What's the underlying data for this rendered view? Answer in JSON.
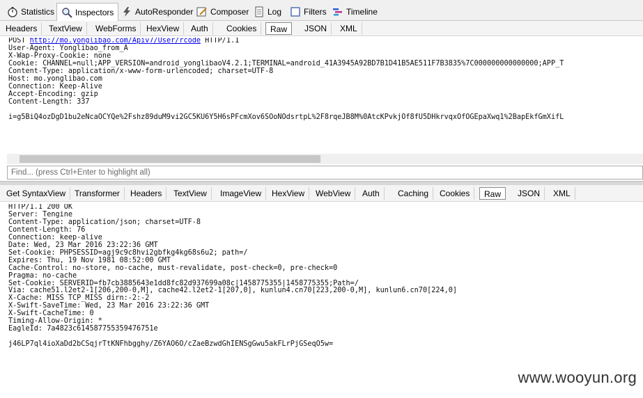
{
  "toolbar": {
    "tabs": [
      {
        "label": "Statistics",
        "icon": "stopwatch-icon"
      },
      {
        "label": "Inspectors",
        "icon": "magnifier-icon"
      },
      {
        "label": "AutoResponder",
        "icon": "lightning-icon"
      },
      {
        "label": "Composer",
        "icon": "pencil-icon"
      },
      {
        "label": "Log",
        "icon": "document-icon"
      },
      {
        "label": "Filters",
        "icon": "checkbox-icon"
      },
      {
        "label": "Timeline",
        "icon": "timeline-icon"
      }
    ],
    "active": "Inspectors"
  },
  "request": {
    "tabs": [
      "Headers",
      "TextView",
      "WebForms",
      "HexView",
      "Auth",
      "Cookies",
      "Raw",
      "JSON",
      "XML"
    ],
    "selected_tab": "Raw",
    "method": "POST ",
    "url": "http://mo.yonglibao.com/Apiv7/User/rcode",
    "protocol": " HTTP/1.1",
    "lines": [
      "User-Agent: Yonglibao_from_A",
      "X-Wap-Proxy-Cookie: none",
      "Cookie: CHANNEL=null;APP_VERSION=android_yonglibaoV4.2.1;TERMINAL=android_41A3945A92BD7B1D41B5AE511F7B3835%7C000000000000000;APP_T",
      "Content-Type: application/x-www-form-urlencoded; charset=UTF-8",
      "Host: mo.yonglibao.com",
      "Connection: Keep-Alive",
      "Accept-Encoding: gzip",
      "Content-Length: 337",
      "",
      "i=g5BiQ4ozDgD1bu2eNcaOCYQe%2Fshz89duM9vi2GC5KU6Y5H6sPFcmXov6SOoNOdsrtpL%2F8rqeJB8M%0AtcKPvkjOf8fU5DHkrvqxOfOGEpaXwq1%2BapEkfGmXifL"
    ]
  },
  "find": {
    "placeholder": "Find... (press Ctrl+Enter to highlight all)"
  },
  "response": {
    "tabs": [
      "Get SyntaxView",
      "Transformer",
      "Headers",
      "TextView",
      "ImageView",
      "HexView",
      "WebView",
      "Auth",
      "Caching",
      "Cookies",
      "Raw",
      "JSON",
      "XML"
    ],
    "selected_tab": "Raw",
    "lines": [
      "HTTP/1.1 200 OK",
      "Server: Tengine",
      "Content-Type: application/json; charset=UTF-8",
      "Content-Length: 76",
      "Connection: keep-alive",
      "Date: Wed, 23 Mar 2016 23:22:36 GMT",
      "Set-Cookie: PHPSESSID=agj9c9c8hvi2gbfkg4kg68s6u2; path=/",
      "Expires: Thu, 19 Nov 1981 08:52:00 GMT",
      "Cache-Control: no-store, no-cache, must-revalidate, post-check=0, pre-check=0",
      "Pragma: no-cache",
      "Set-Cookie: SERVERID=fb7cb3885643e1dd8fc82d937699a08c|1458775355|1458775355;Path=/",
      "Via: cache51.l2et2-1[206,200-0,M], cache42.l2et2-1[207,0], kunlun4.cn70[223,200-0,M], kunlun6.cn70[224,0]",
      "X-Cache: MISS TCP_MISS dirn:-2:-2",
      "X-Swift-SaveTime: Wed, 23 Mar 2016 23:22:36 GMT",
      "X-Swift-CacheTime: 0",
      "Timing-Allow-Origin: *",
      "EagleId: 7a4823c614587755359476751e",
      "",
      "j46LP7ql4ioXaDd2bCSqjrTtKNFhbgghy/Z6YAO6O/cZaeBzwdGhIENSgGwu5akFLrPjGSeqO5w="
    ]
  },
  "watermark": "www.wooyun.org"
}
